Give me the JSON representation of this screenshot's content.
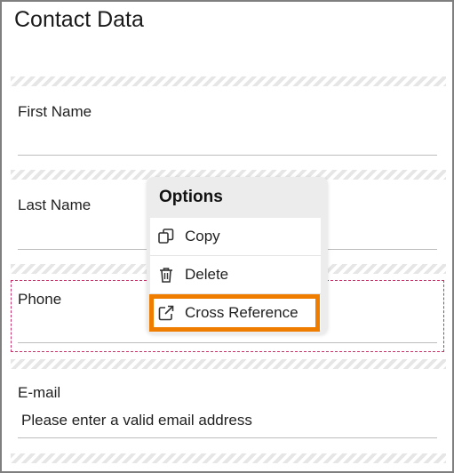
{
  "form": {
    "title": "Contact Data",
    "fields": [
      {
        "label": "First Name",
        "value": ""
      },
      {
        "label": "Last Name",
        "value": ""
      },
      {
        "label": "Phone",
        "value": ""
      },
      {
        "label": "E-mail",
        "value": "Please enter a valid email address"
      }
    ]
  },
  "popup": {
    "title": "Options",
    "items": [
      {
        "label": "Copy",
        "icon": "copy-icon"
      },
      {
        "label": "Delete",
        "icon": "trash-icon"
      },
      {
        "label": "Cross Reference",
        "icon": "external-link-icon"
      }
    ]
  },
  "colors": {
    "highlight": "#ef7d00",
    "focus_dashed": "#c8336b",
    "popup_bg": "#ececec"
  }
}
